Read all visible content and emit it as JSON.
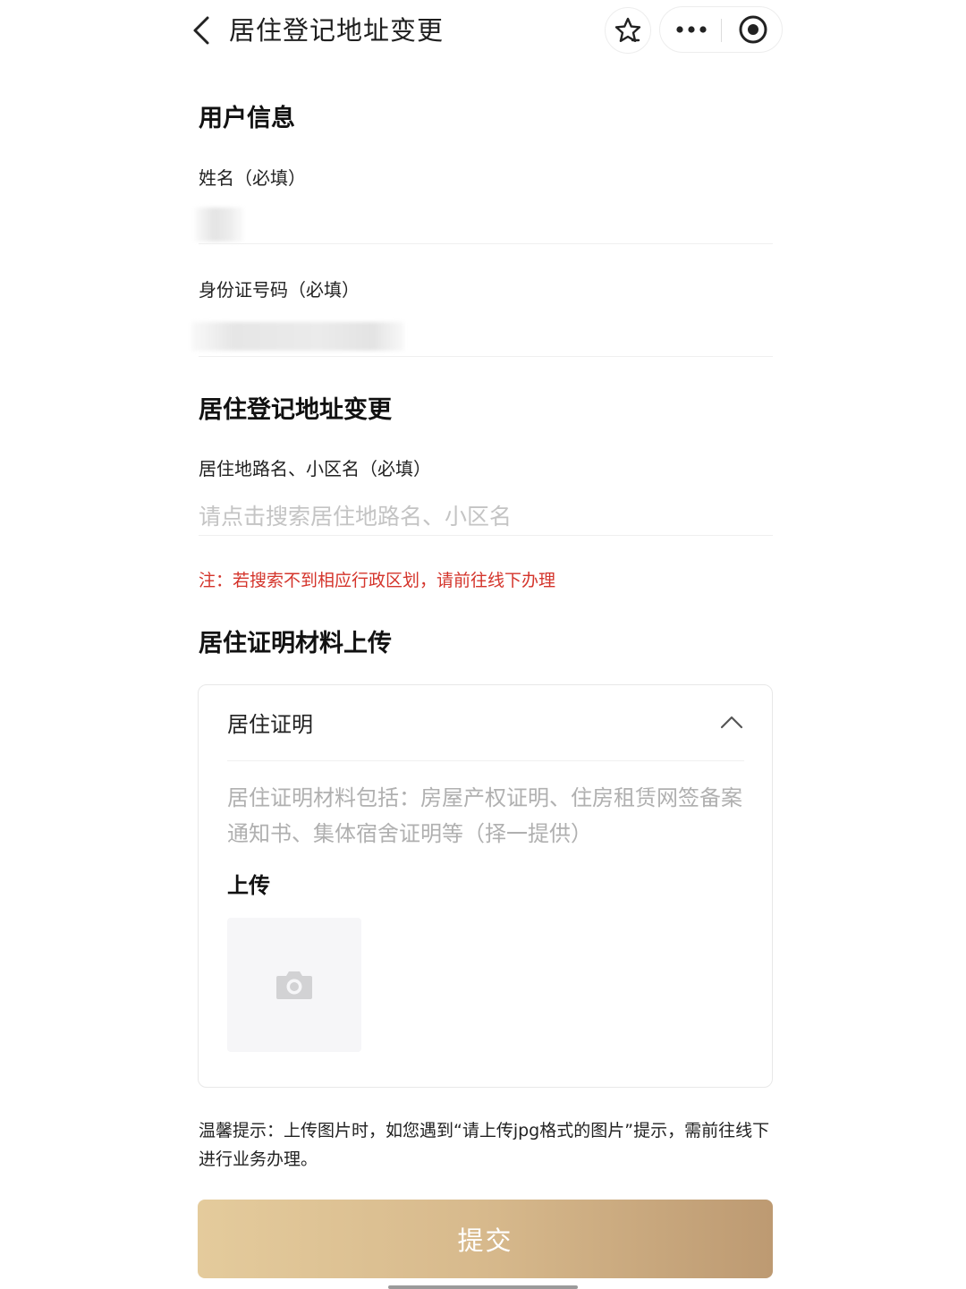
{
  "header": {
    "title": "居住登记地址变更",
    "back_icon": "chevron-left-icon",
    "star_icon": "star-icon",
    "more_icon": "more-dots-icon",
    "target_icon": "target-icon"
  },
  "user_info": {
    "section_title": "用户信息",
    "name_label": "姓名（必填）",
    "id_label": "身份证号码（必填）"
  },
  "address_change": {
    "section_title": "居住登记地址变更",
    "road_label": "居住地路名、小区名（必填）",
    "road_placeholder": "请点击搜索居住地路名、小区名",
    "note": "注：若搜索不到相应行政区划，请前往线下办理"
  },
  "upload_section": {
    "section_title": "居住证明材料上传",
    "card_title": "居住证明",
    "card_description": "居住证明材料包括：房屋产权证明、住房租赁网签备案通知书、集体宿舍证明等（择一提供）",
    "upload_label": "上传",
    "upload_icon": "camera-icon"
  },
  "tip": "温馨提示：上传图片时，如您遇到“请上传jpg格式的图片”提示，需前往线下进行业务办理。",
  "submit_label": "提交",
  "colors": {
    "note_red": "#d4342b",
    "submit_gradient_start": "#e4cb9c",
    "submit_gradient_end": "#bd9a72"
  }
}
